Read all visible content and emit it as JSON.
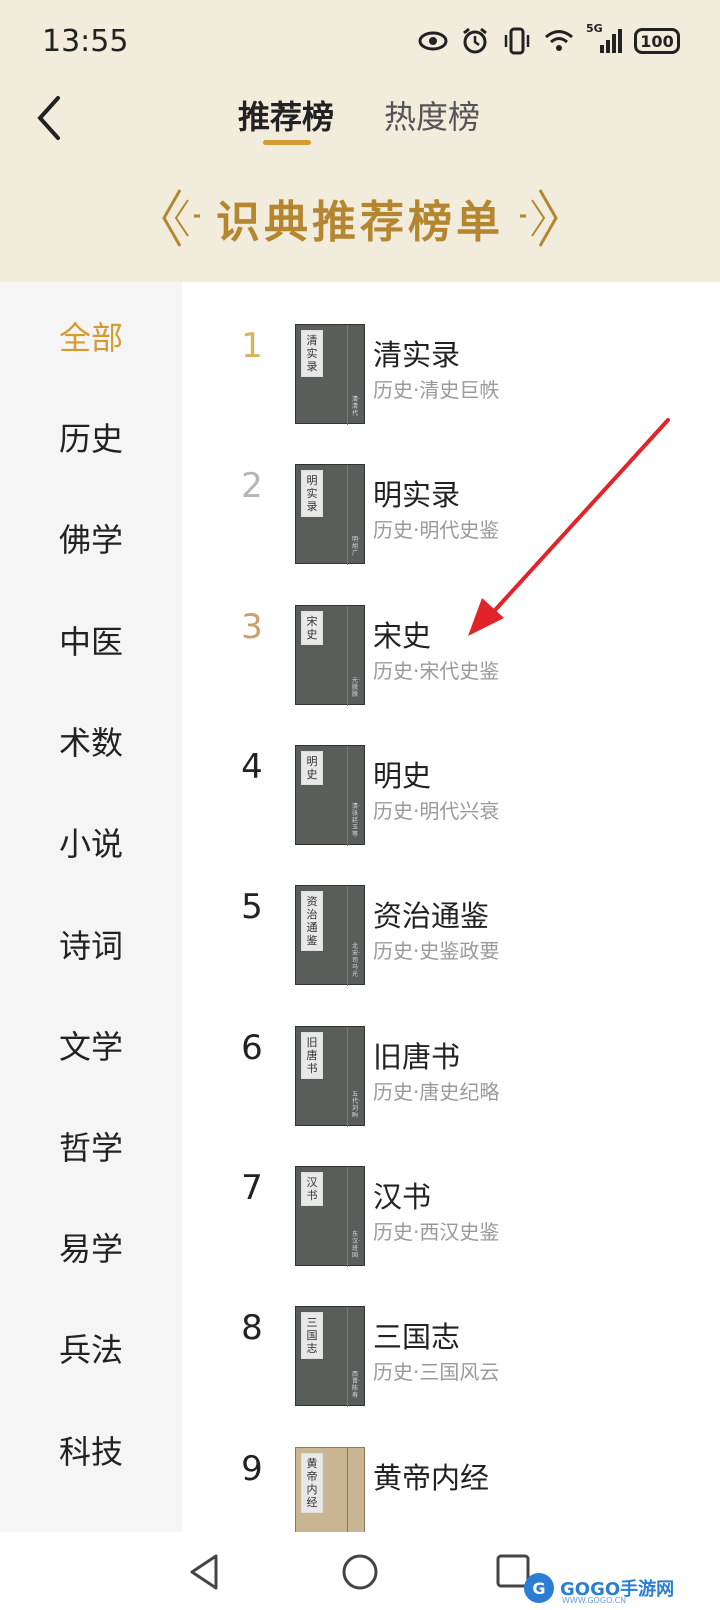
{
  "status_bar": {
    "time": "13:55",
    "network": "5G",
    "battery": "100"
  },
  "header": {
    "tabs": [
      {
        "label": "推荐榜",
        "active": true
      },
      {
        "label": "热度榜",
        "active": false
      }
    ],
    "banner_title": "识典推荐榜单"
  },
  "colors": {
    "accent": "#d69a33",
    "banner_gold": "#b48630",
    "header_bg": "#f2ecdd",
    "arrow": "#e0242a",
    "rank_gold": "#d9b15e",
    "rank_silver": "#b5b5b5",
    "rank_bronze": "#c9a06b"
  },
  "sidebar": {
    "categories": [
      "全部",
      "历史",
      "佛学",
      "中医",
      "术数",
      "小说",
      "诗词",
      "文学",
      "哲学",
      "易学",
      "兵法",
      "科技"
    ],
    "selected": "全部"
  },
  "books": [
    {
      "rank": "1",
      "title": "清实录",
      "subtitle": "历史·清史巨帙",
      "cover_label": "清实录",
      "cover_author": "清·清代"
    },
    {
      "rank": "2",
      "title": "明实录",
      "subtitle": "历史·明代史鉴",
      "cover_label": "明实录",
      "cover_author": "明·胡广"
    },
    {
      "rank": "3",
      "title": "宋史",
      "subtitle": "历史·宋代史鉴",
      "cover_label": "宋史",
      "cover_author": "元·脱脱"
    },
    {
      "rank": "4",
      "title": "明史",
      "subtitle": "历史·明代兴衰",
      "cover_label": "明史",
      "cover_author": "清·张廷玉等"
    },
    {
      "rank": "5",
      "title": "资治通鉴",
      "subtitle": "历史·史鉴政要",
      "cover_label": "资治通鉴",
      "cover_author": "北宋·司马光"
    },
    {
      "rank": "6",
      "title": "旧唐书",
      "subtitle": "历史·唐史纪略",
      "cover_label": "旧唐书",
      "cover_author": "五代·刘昫"
    },
    {
      "rank": "7",
      "title": "汉书",
      "subtitle": "历史·西汉史鉴",
      "cover_label": "汉书",
      "cover_author": "东汉·班固"
    },
    {
      "rank": "8",
      "title": "三国志",
      "subtitle": "历史·三国风云",
      "cover_label": "三国志",
      "cover_author": "西晋·陈寿"
    },
    {
      "rank": "9",
      "title": "黄帝内经",
      "subtitle": "",
      "cover_label": "黄帝内经",
      "cover_author": ""
    }
  ],
  "watermark": {
    "text": "GOGO手游网",
    "sub": "WWW.GOGO.CN"
  }
}
